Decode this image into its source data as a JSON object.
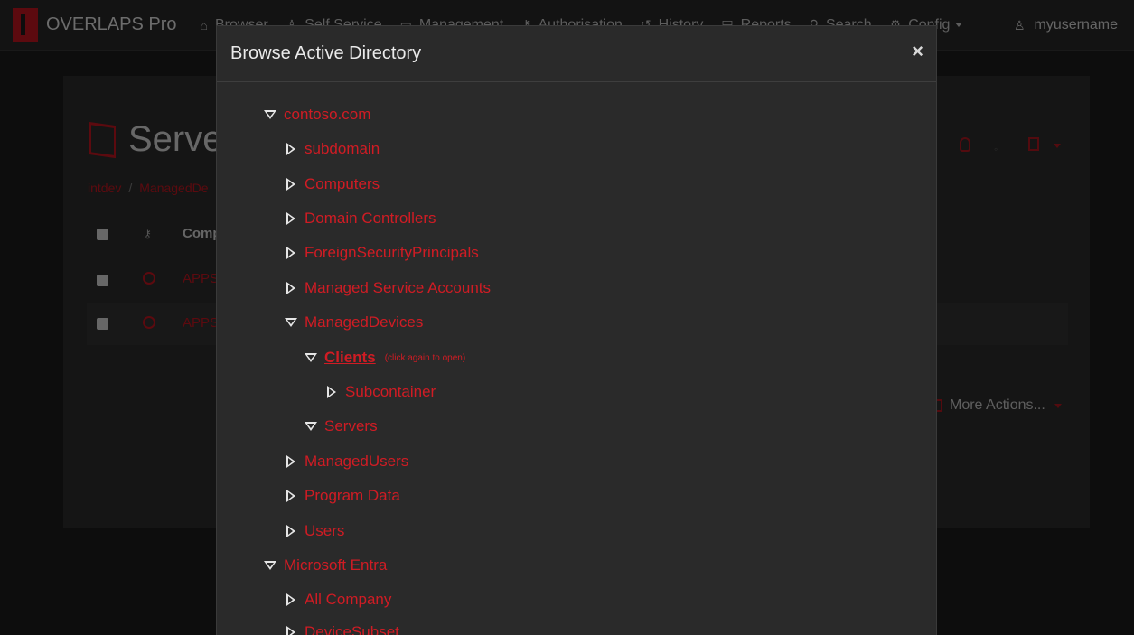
{
  "navbar": {
    "brand": "OVERLAPS Pro",
    "items": [
      {
        "label": "Browser",
        "icon": "home-icon"
      },
      {
        "label": "Self Service",
        "icon": "person-icon"
      },
      {
        "label": "Management",
        "icon": "monitor-icon"
      },
      {
        "label": "Authorisation",
        "icon": "key-icon"
      },
      {
        "label": "History",
        "icon": "history-icon"
      },
      {
        "label": "Reports",
        "icon": "report-icon"
      },
      {
        "label": "Search",
        "icon": "search-icon"
      },
      {
        "label": "Config",
        "icon": "gear-icon"
      }
    ],
    "user": "myusername"
  },
  "background": {
    "page_title": "Server",
    "breadcrumb": [
      "intdev",
      "ManagedDe"
    ],
    "table_header": {
      "computer": "Comp"
    },
    "rows": [
      {
        "name": "APPS"
      },
      {
        "name": "APPS"
      }
    ],
    "more_actions": "More Actions..."
  },
  "modal": {
    "title": "Browse Active Directory",
    "close_symbol": "×",
    "selected_hint": "(click again to open)",
    "tree": [
      {
        "label": "contoso.com",
        "expanded": true
      },
      {
        "label": "subdomain",
        "expanded": false
      },
      {
        "label": "Computers",
        "expanded": false
      },
      {
        "label": "Domain Controllers",
        "expanded": false
      },
      {
        "label": "ForeignSecurityPrincipals",
        "expanded": false
      },
      {
        "label": "Managed Service Accounts",
        "expanded": false
      },
      {
        "label": "ManagedDevices",
        "expanded": true
      },
      {
        "label": "Clients",
        "expanded": true,
        "selected": true
      },
      {
        "label": "Subcontainer",
        "expanded": false
      },
      {
        "label": "Servers",
        "expanded": true
      },
      {
        "label": "ManagedUsers",
        "expanded": false
      },
      {
        "label": "Program Data",
        "expanded": false
      },
      {
        "label": "Users",
        "expanded": false
      },
      {
        "label": "Microsoft Entra",
        "expanded": true
      },
      {
        "label": "All Company",
        "expanded": false
      },
      {
        "label": "DeviceSubset",
        "expanded": false
      }
    ]
  },
  "colors": {
    "accent": "#d01c24",
    "background": "#1a1a1a",
    "modal": "#2a2a2a"
  }
}
